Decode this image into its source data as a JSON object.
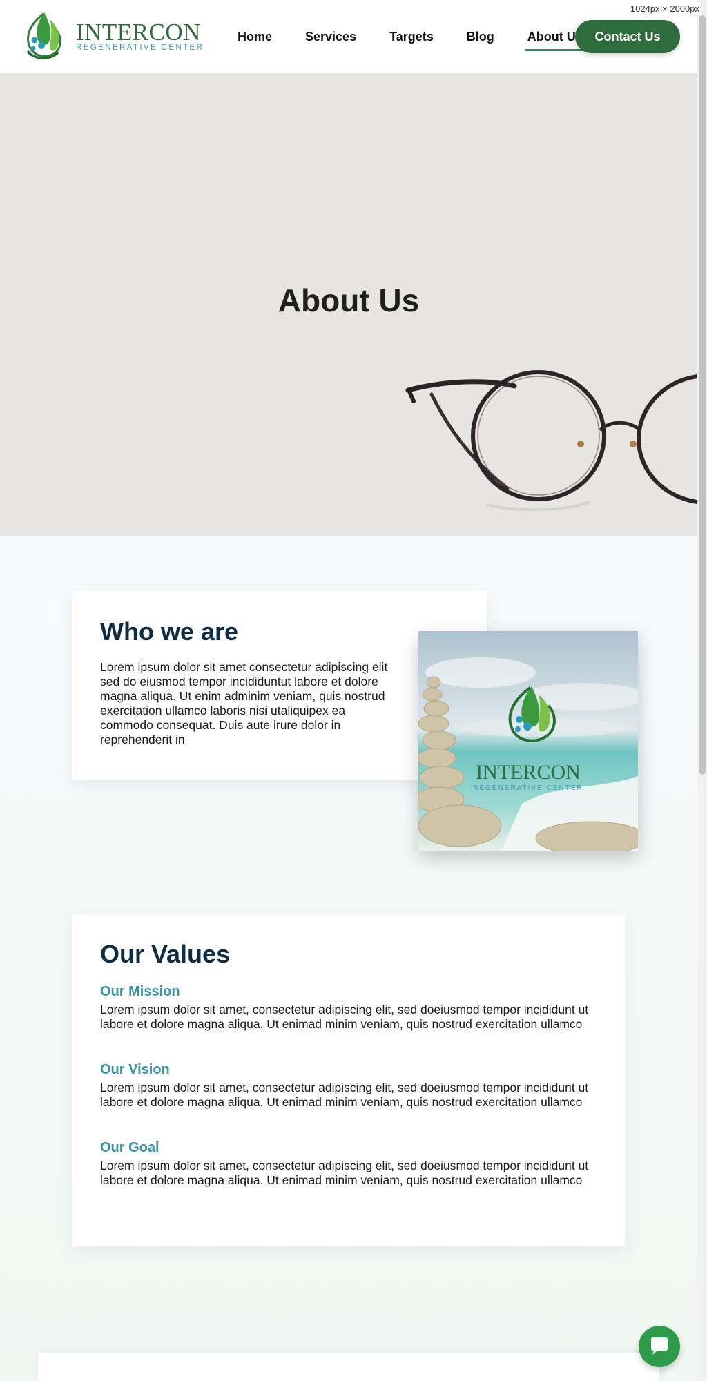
{
  "viewport_label": "1024px × 2000px",
  "brand": {
    "name": "INTERCON",
    "tagline": "REGENERATIVE CENTER",
    "primary_color": "#2e6b3d",
    "accent_color": "#3a92a8"
  },
  "nav": {
    "items": [
      {
        "label": "Home",
        "active": false
      },
      {
        "label": "Services",
        "active": false
      },
      {
        "label": "Targets",
        "active": false
      },
      {
        "label": "Blog",
        "active": false
      },
      {
        "label": "About Us",
        "active": true
      }
    ],
    "cta_label": "Contact Us"
  },
  "hero": {
    "title": "About Us",
    "image_icon": "eyeglasses"
  },
  "who": {
    "heading": "Who we are",
    "text": "Lorem ipsum dolor sit amet consectetur adipiscing elit sed do eiusmod tempor incididuntut labore et dolore magna aliqua. Ut enim adminim veniam, quis nostrud exercitation ullamco laboris nisi utaliquipex ea commodo consequat. Duis aute irure dolor in reprehenderit in",
    "image": {
      "brand_name": "INTERCON",
      "brand_tagline": "REGENERATIVE CENTER"
    }
  },
  "values": {
    "heading": "Our Values",
    "items": [
      {
        "title": "Our Mission",
        "text": "Lorem ipsum dolor sit amet, consectetur adipiscing elit, sed doeiusmod tempor incididunt ut labore et dolore magna aliqua. Ut enimad minim veniam, quis nostrud exercitation ullamco"
      },
      {
        "title": "Our Vision",
        "text": "Lorem ipsum dolor sit amet, consectetur adipiscing elit, sed doeiusmod tempor incididunt ut labore et dolore magna aliqua. Ut enimad minim veniam, quis nostrud exercitation ullamco"
      },
      {
        "title": "Our Goal",
        "text": "Lorem ipsum dolor sit amet, consectetur adipiscing elit, sed doeiusmod tempor incididunt ut labore et dolore magna aliqua. Ut enimad minim veniam, quis nostrud exercitation ullamco"
      }
    ]
  },
  "chat": {
    "icon": "chat-bubble-icon"
  }
}
